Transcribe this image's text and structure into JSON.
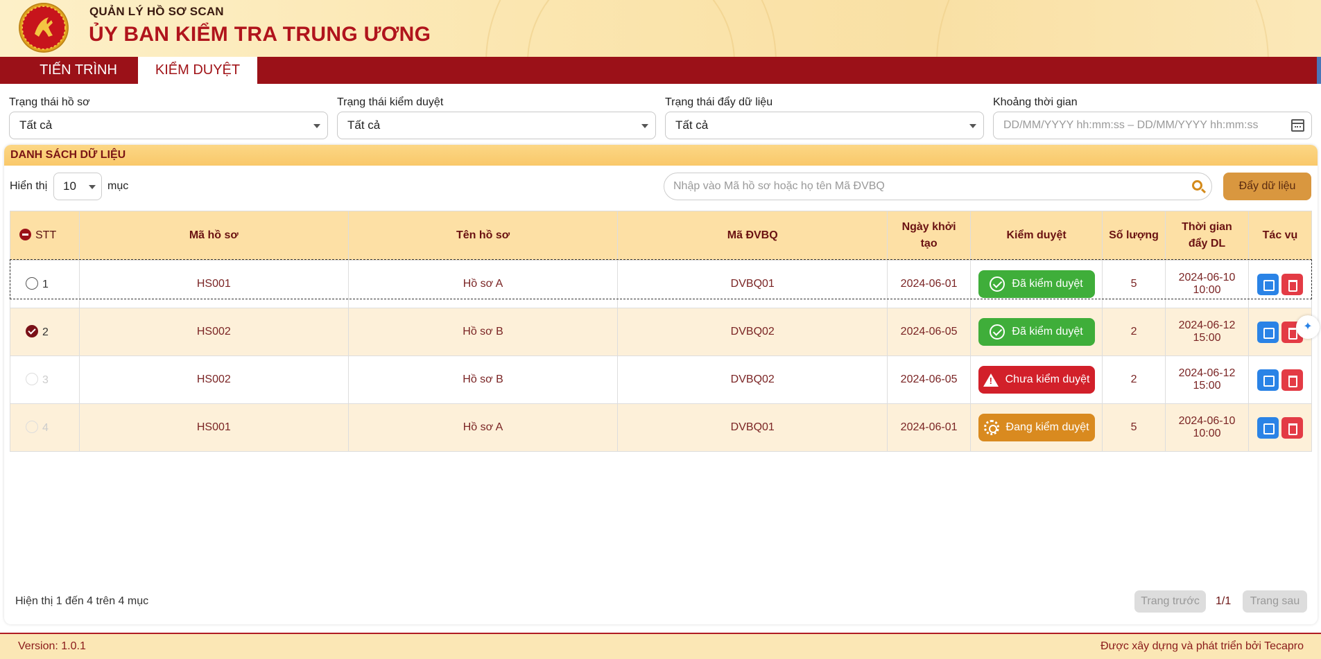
{
  "header": {
    "subtitle": "QUẢN LÝ HỒ SƠ SCAN",
    "title": "ỦY BAN KIỂM TRA TRUNG ƯƠNG",
    "colors": {
      "brand_red": "#b0141c",
      "bar_red": "#9b1118",
      "header_bg": "#fbe6b0"
    }
  },
  "tabs": [
    {
      "label": "TIẾN TRÌNH",
      "active": false
    },
    {
      "label": "KIỂM DUYỆT",
      "active": true
    }
  ],
  "filters": {
    "record_status": {
      "label": "Trạng thái hồ sơ",
      "value": "Tất cả"
    },
    "review_status": {
      "label": "Trạng thái kiểm duyệt",
      "value": "Tất cả"
    },
    "push_status": {
      "label": "Trạng thái đẩy dữ liệu",
      "value": "Tất cả"
    },
    "time_range": {
      "label": "Khoảng thời gian",
      "placeholder": "DD/MM/YYYY hh:mm:ss – DD/MM/YYYY hh:mm:ss"
    }
  },
  "panel": {
    "title": "DANH SÁCH DỮ LIỆU",
    "show_label": "Hiển thị",
    "page_size": "10",
    "items_label": "mục",
    "search_placeholder": "Nhập vào Mã hồ sơ hoặc họ tên Mã ĐVBQ",
    "push_button": "Đẩy dữ liệu"
  },
  "table": {
    "headers": {
      "stt": "STT",
      "code": "Mã hồ sơ",
      "name": "Tên hồ sơ",
      "unit": "Mã ĐVBQ",
      "created": "Ngày khởi tạo",
      "review": "Kiểm duyệt",
      "qty": "Số lượng",
      "push_time": "Thời gian đẩy DL",
      "actions": "Tác vụ"
    },
    "rows": [
      {
        "stt": "1",
        "code": "HS001",
        "name": "Hồ sơ A",
        "unit": "DVBQ01",
        "created": "2024-06-01",
        "review": "Đã kiểm duyệt",
        "review_type": "approved",
        "qty": "5",
        "push_date": "2024-06-10",
        "push_clock": "10:00",
        "selection": "empty"
      },
      {
        "stt": "2",
        "code": "HS002",
        "name": "Hồ sơ B",
        "unit": "DVBQ02",
        "created": "2024-06-05",
        "review": "Đã kiểm duyệt",
        "review_type": "approved",
        "qty": "2",
        "push_date": "2024-06-12",
        "push_clock": "15:00",
        "selection": "checked"
      },
      {
        "stt": "3",
        "code": "HS002",
        "name": "Hồ sơ B",
        "unit": "DVBQ02",
        "created": "2024-06-05",
        "review": "Chưa kiểm duyệt",
        "review_type": "pending",
        "qty": "2",
        "push_date": "2024-06-12",
        "push_clock": "15:00",
        "selection": "disabled"
      },
      {
        "stt": "4",
        "code": "HS001",
        "name": "Hồ sơ A",
        "unit": "DVBQ01",
        "created": "2024-06-01",
        "review": "Đang kiểm duyệt",
        "review_type": "in_progress",
        "qty": "5",
        "push_date": "2024-06-10",
        "push_clock": "10:00",
        "selection": "disabled"
      }
    ]
  },
  "pagination": {
    "info": "Hiện thị 1 đến 4 trên 4 mục",
    "prev": "Trang trước",
    "page": "1/1",
    "next": "Trang sau"
  },
  "footer": {
    "version": "Version: 1.0.1",
    "credit": "Được xây dựng và phát triển bởi Tecapro"
  }
}
